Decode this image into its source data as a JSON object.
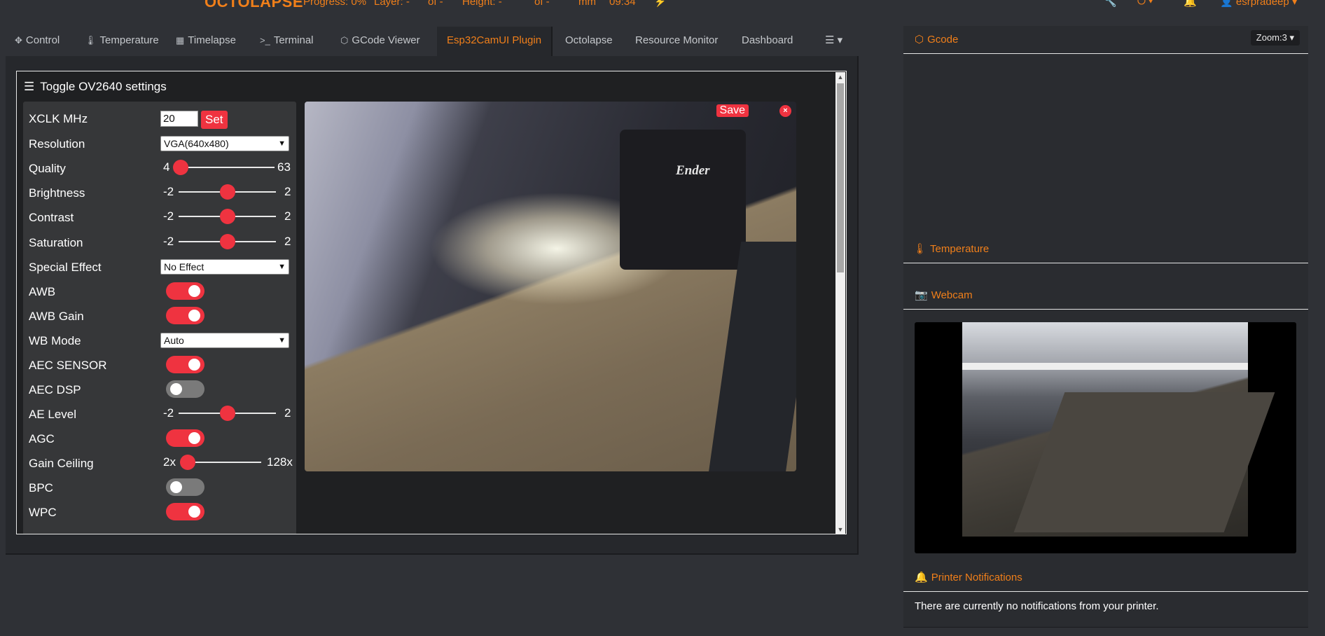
{
  "topbar": {
    "brand": "OCTOLAPSE",
    "progress": "Progress: 0%",
    "layer": "Layer: -",
    "layer_of": "of -",
    "height": "Height: -",
    "height_of": "of -",
    "unit": "mm",
    "time": "09:34",
    "user": "esrpradeep"
  },
  "tabs": [
    {
      "label": "Control",
      "icon": "arrows-icon"
    },
    {
      "label": "Temperature",
      "icon": "thermometer-icon"
    },
    {
      "label": "Timelapse",
      "icon": "film-icon"
    },
    {
      "label": "Terminal",
      "icon": "terminal-icon"
    },
    {
      "label": "GCode Viewer",
      "icon": "cube-icon"
    },
    {
      "label": "Esp32CamUI Plugin",
      "icon": ""
    },
    {
      "label": "Octolapse",
      "icon": ""
    },
    {
      "label": "Resource Monitor",
      "icon": ""
    },
    {
      "label": "Dashboard",
      "icon": ""
    }
  ],
  "panel": {
    "toggle_label": "Toggle OV2640 settings",
    "save_label": "Save",
    "close_label": "×",
    "camera_text": "Ender"
  },
  "settings": {
    "xclk": {
      "label": "XCLK MHz",
      "value": "20",
      "button": "Set"
    },
    "resolution": {
      "label": "Resolution",
      "value": "VGA(640x480)"
    },
    "quality": {
      "label": "Quality",
      "min": "4",
      "max": "63",
      "value": 4
    },
    "brightness": {
      "label": "Brightness",
      "min": "-2",
      "max": "2",
      "value": 0
    },
    "contrast": {
      "label": "Contrast",
      "min": "-2",
      "max": "2",
      "value": 0
    },
    "saturation": {
      "label": "Saturation",
      "min": "-2",
      "max": "2",
      "value": 0
    },
    "special_effect": {
      "label": "Special Effect",
      "value": "No Effect"
    },
    "awb": {
      "label": "AWB",
      "on": true
    },
    "awb_gain": {
      "label": "AWB Gain",
      "on": true
    },
    "wb_mode": {
      "label": "WB Mode",
      "value": "Auto"
    },
    "aec_sensor": {
      "label": "AEC SENSOR",
      "on": true
    },
    "aec_dsp": {
      "label": "AEC DSP",
      "on": false
    },
    "ae_level": {
      "label": "AE Level",
      "min": "-2",
      "max": "2",
      "value": 0
    },
    "agc": {
      "label": "AGC",
      "on": true
    },
    "gain_ceiling": {
      "label": "Gain Ceiling",
      "min": "2x",
      "max": "128x",
      "value": "2x"
    },
    "bpc": {
      "label": "BPC",
      "on": false
    },
    "wpc": {
      "label": "WPC",
      "on": true
    }
  },
  "sidebar": {
    "gcode": "Gcode",
    "zoom": "Zoom:3",
    "temperature": "Temperature",
    "webcam": "Webcam",
    "notifications": "Printer Notifications",
    "notifications_text": "There are currently no notifications from your printer."
  },
  "colors": {
    "accent": "#f07f1a",
    "red": "#ef3340",
    "bg": "#2f3136"
  }
}
